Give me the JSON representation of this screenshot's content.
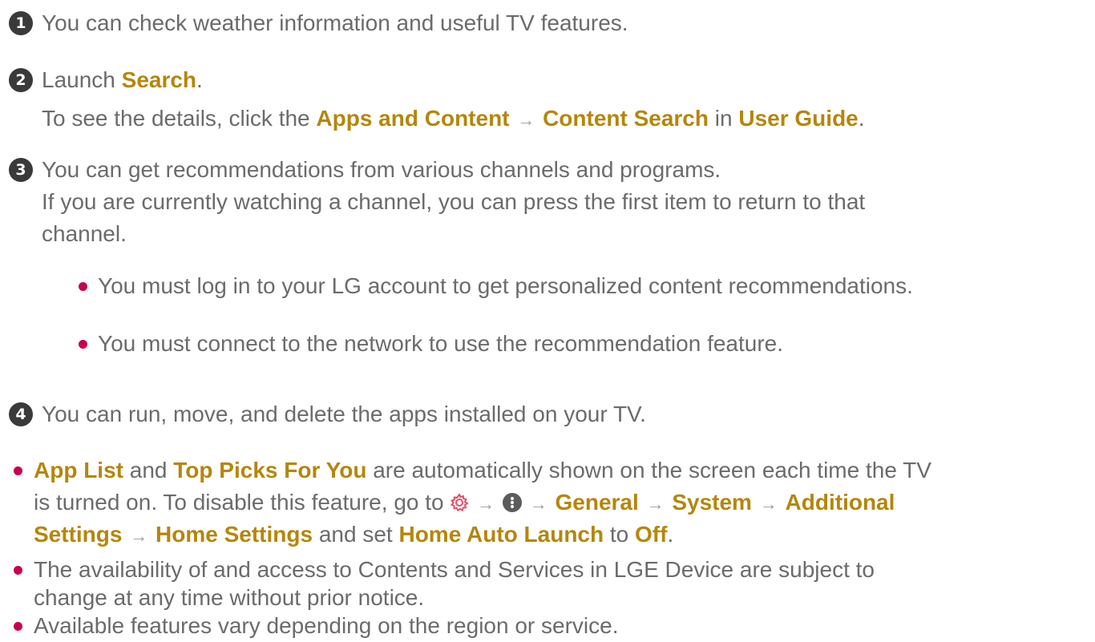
{
  "items": {
    "item1": {
      "number": "1",
      "text": "You can check weather information and useful TV features."
    },
    "item2": {
      "number": "2",
      "launch": "Launch ",
      "search": "Search",
      "period1": ".",
      "details_prefix": "To see the details, click the ",
      "apps_content": "Apps and Content",
      "content_search": "Content Search",
      "in": " in ",
      "user_guide": "User Guide",
      "period2": "."
    },
    "item3": {
      "number": "3",
      "line1": "You can get recommendations from various channels and programs.",
      "line2": "If you are currently watching a channel, you can press the first item to return to that",
      "line3": "channel.",
      "sub_bullets": [
        "You must log in to your LG account to get personalized content recommendations.",
        "You must connect to the network to use the recommendation feature."
      ]
    },
    "item4": {
      "number": "4",
      "text": "You can run, move, and delete the apps installed on your TV."
    }
  },
  "notes": {
    "note1": {
      "app_list": "App List",
      "and": " and ",
      "top_picks": "Top Picks For You",
      "rest1": " are automatically shown on the screen each time the TV",
      "line2_prefix": "is turned on. To disable this feature, go to ",
      "general": "General",
      "system": "System",
      "additional": "Additional",
      "settings": "Settings",
      "home_settings": "Home Settings",
      "and_set": " and set ",
      "home_auto_launch": "Home Auto Launch",
      "to": " to ",
      "off": "Off",
      "period": "."
    },
    "note2": {
      "line1": "The availability of and access to Contents and Services in LGE Device are subject to",
      "line2": "change at any time without prior notice."
    },
    "note3": {
      "text": "Available features vary depending on the region or service."
    }
  },
  "icons": {
    "arrow": "→",
    "settings_icon": "gear-icon",
    "more_icon": "more-vertical-icon"
  },
  "colors": {
    "text": "#6b6b6b",
    "highlight": "#b5860b",
    "bullet": "#c9004f",
    "number_badge": "#3a3a3a",
    "settings_icon": "#e0506a"
  }
}
